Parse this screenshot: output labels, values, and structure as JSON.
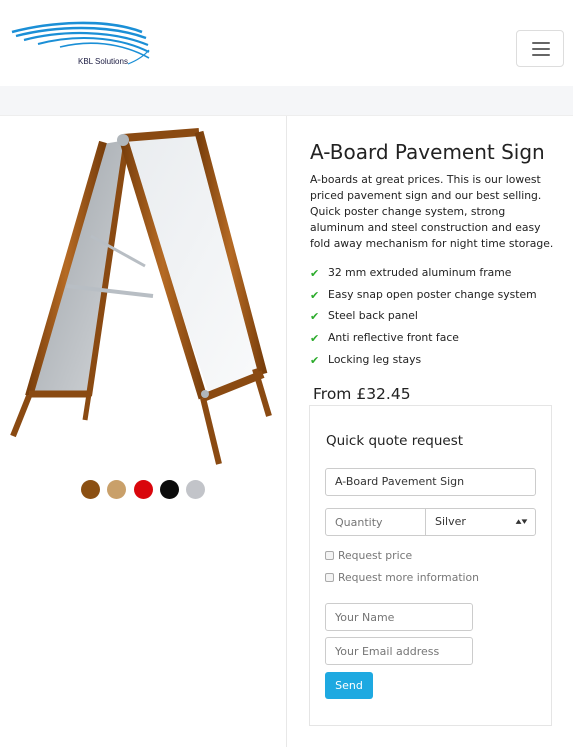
{
  "brand": {
    "name": "KBL Solutions",
    "accent": "#1b8fd6"
  },
  "navbar": {
    "menu_icon": "hamburger-menu-icon"
  },
  "product": {
    "title": "A-Board Pavement Sign",
    "description": "A-boards at great prices. This is our lowest priced pavement sign and our best selling. Quick poster change system, strong aluminum and steel construction and easy fold away mechanism for night time storage.",
    "features": [
      "32 mm extruded aluminum frame",
      "Easy snap open poster change system",
      "Steel back panel",
      "Anti reflective front face",
      "Locking leg stays"
    ],
    "feature_icon": "check-icon",
    "price": "From £32.45",
    "color_swatches": [
      "#8b4f12",
      "#c9a06a",
      "#d9060c",
      "#0b0b0b",
      "#c2c4c9"
    ]
  },
  "quote": {
    "title": "Quick quote request",
    "product_value": "A-Board Pavement Sign",
    "quantity_placeholder": "Quantity",
    "color_selected": "Silver",
    "request_price_label": "Request price",
    "request_info_label": "Request more information",
    "name_placeholder": "Your Name",
    "email_placeholder": "Your Email address",
    "send_label": "Send",
    "send_color": "#1ea9e1"
  }
}
